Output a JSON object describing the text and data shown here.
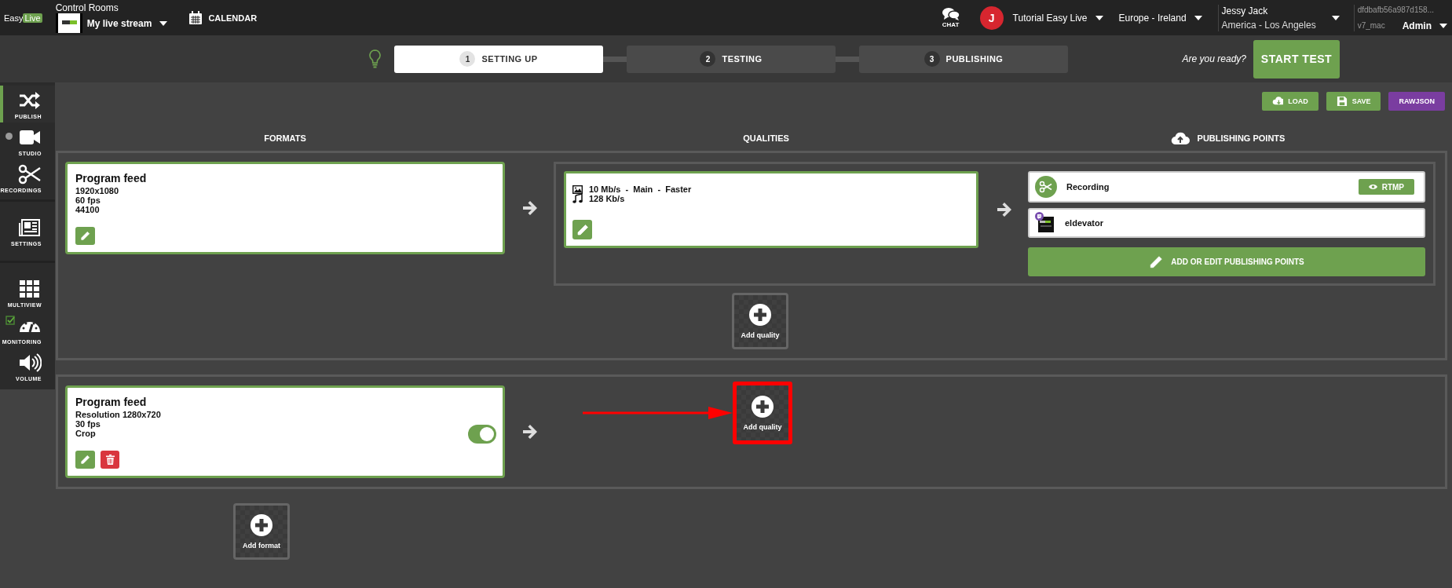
{
  "top_bar": {
    "logo": {
      "part_1": "Easy",
      "part_2": "Live"
    },
    "control_room": {
      "label": "Control Rooms",
      "name": "My live stream"
    },
    "calendar": "CALENDAR",
    "chat": "CHAT",
    "avatar": "J",
    "organization": "Tutorial Easy Live",
    "region": "Europe - Ireland",
    "user": {
      "name": "Jessy Jack",
      "timezone": "America - Los Angeles"
    },
    "build": {
      "hash": "dfdbafb56a987d158...",
      "env": "v7_mac",
      "role": "Admin"
    }
  },
  "steps": [
    {
      "number": "1",
      "label": "SETTING UP",
      "selected": true
    },
    {
      "number": "2",
      "label": "TESTING",
      "selected": false
    },
    {
      "number": "3",
      "label": "PUBLISHING",
      "selected": false
    }
  ],
  "ready_prompt": "Are you ready?",
  "start_button": "START TEST",
  "sidebar": {
    "groups": [
      {
        "items": [
          {
            "label": "PUBLISH",
            "selected": true
          },
          {
            "label": "STUDIO",
            "selected": false,
            "live": false
          },
          {
            "label": "RECORDINGS",
            "selected": false
          }
        ]
      },
      {
        "items": [
          {
            "label": "SETTINGS",
            "selected": false
          }
        ]
      },
      {
        "items": [
          {
            "label": "MULTIVIEW",
            "selected": false
          },
          {
            "label": "MONITORING",
            "selected": false,
            "checked": true
          },
          {
            "label": "VOLUME",
            "selected": false
          }
        ]
      }
    ]
  },
  "toolbar": [
    {
      "label": "LOAD",
      "kind": "primary"
    },
    {
      "label": "SAVE",
      "kind": "primary"
    },
    {
      "label": "RAWJSON",
      "kind": "secondary"
    }
  ],
  "columns": [
    "FORMATS",
    "QUALITIES",
    "PUBLISHING POINTS"
  ],
  "formats": [
    {
      "title": "Program feed",
      "details": [
        "1920x1080",
        "60 fps",
        "44100"
      ],
      "deletable": false,
      "qualities": [
        {
          "video": "10 Mb/s  -  Main  -  Faster",
          "audio": "128 Kb/s",
          "publishing_points": [
            {
              "name": "Recording",
              "kind": "recording",
              "badge": "RTMP"
            },
            {
              "name": "eldevator",
              "kind": "stream"
            }
          ],
          "publishing_action": "ADD OR EDIT PUBLISHING POINTS"
        }
      ],
      "add_quality": {
        "label": "Add quality",
        "highlighted": false
      }
    },
    {
      "title": "Program feed",
      "details": [
        "Resolution 1280x720",
        "30 fps",
        "Crop"
      ],
      "deletable": true,
      "toggle": {
        "on": true
      },
      "add_quality": {
        "label": "Add quality",
        "highlighted": true
      }
    }
  ],
  "add_format": "Add format"
}
